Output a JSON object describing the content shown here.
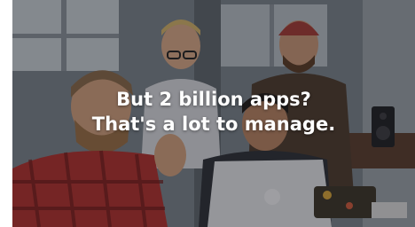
{
  "video_frame": {
    "caption_line1": "But 2 billion apps?",
    "caption_line2": "That's a lot to manage."
  },
  "colors": {
    "caption_text": "#ffffff",
    "dim_overlay": "#14161a"
  }
}
